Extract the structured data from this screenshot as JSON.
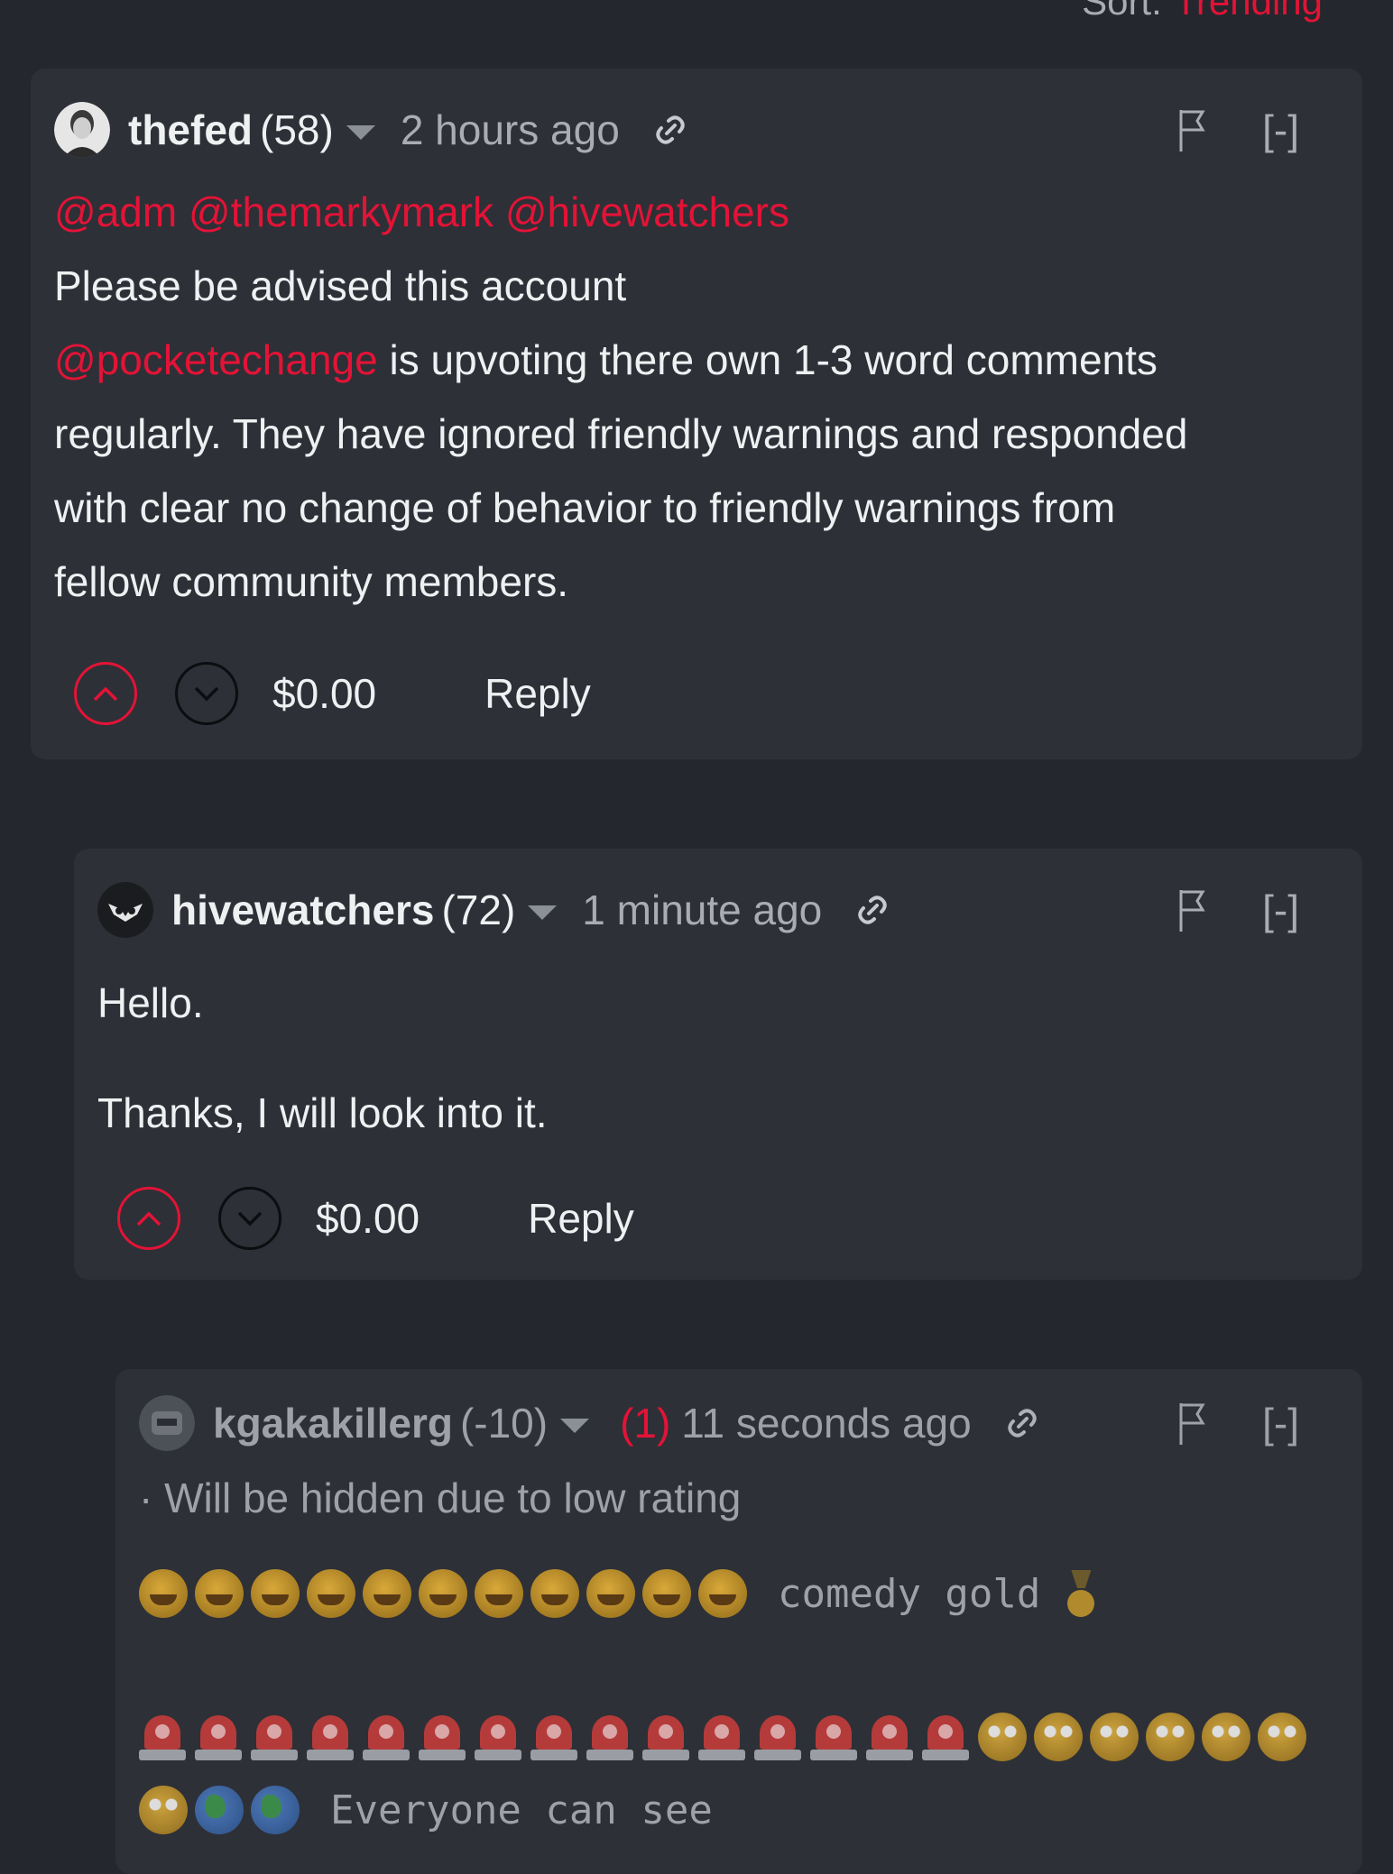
{
  "sort": {
    "label": "Sort:",
    "value": "Trending"
  },
  "comments": [
    {
      "author": "thefed",
      "reputation": "(58)",
      "time": "2 hours ago",
      "collapse": "[-]",
      "mentions": "@adm @themarkymark @hivewatchers",
      "line1": "Please be advised this account",
      "mention_inline": "@pocketechange",
      "line2_rest": " is upvoting there own 1-3 word comments",
      "line3": "regularly. They have ignored friendly warnings and responded",
      "line4": "with clear no change of behavior to friendly warnings from",
      "line5": "fellow community members.",
      "amount": "$0.00",
      "reply": "Reply"
    },
    {
      "author": "hivewatchers",
      "reputation": "(72)",
      "time": "1 minute ago",
      "collapse": "[-]",
      "para1": "Hello.",
      "para2": "Thanks, I will look into it.",
      "amount": "$0.00",
      "reply": "Reply"
    },
    {
      "author": "kgakakillerg",
      "reputation": "(-10)",
      "flag_count": "(1)",
      "time": "11 seconds ago",
      "collapse": "[-]",
      "hidden_note": "· Will be hidden due to low rating",
      "text1": "comedy gold",
      "text2": "Everyone can see",
      "icons": {
        "laugh": "face-with-tears-of-joy-emoji",
        "siren": "police-light-emoji",
        "roll": "rolling-eyes-emoji",
        "globe": "globe-emoji",
        "medal": "medal-emoji"
      }
    }
  ],
  "colors": {
    "accent": "#e31337",
    "card": "#2d3036",
    "background": "#24272d"
  }
}
